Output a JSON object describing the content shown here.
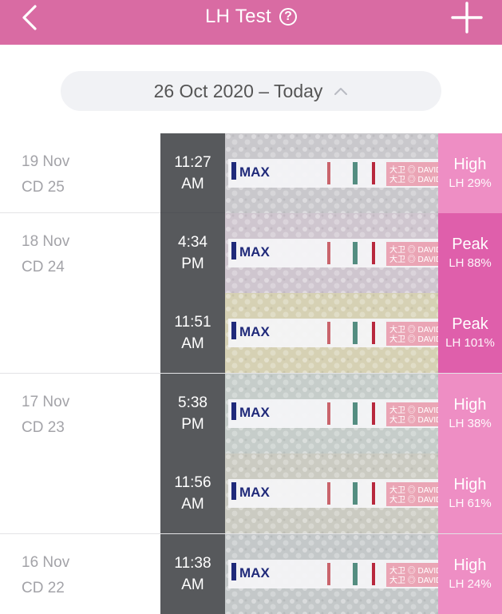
{
  "header": {
    "title": "LH Test",
    "help_symbol": "?",
    "back_icon": "chevron-left-icon",
    "add_icon": "plus-icon",
    "background_color": "#d96ba3"
  },
  "date_range": {
    "label": "26 Oct 2020 – Today",
    "toggle_icon": "chevron-up-icon"
  },
  "tests": [
    {
      "date": "19 Nov",
      "cycle_day": "CD 25",
      "time": "11:27",
      "ampm": "AM",
      "result": "High",
      "lh": "LH 29%",
      "strip_text": "MAX"
    },
    {
      "date": "18 Nov",
      "cycle_day": "CD 24",
      "time": "4:34",
      "ampm": "PM",
      "result": "Peak",
      "lh": "LH 88%",
      "strip_text": "MAX"
    },
    {
      "date": "",
      "cycle_day": "",
      "time": "11:51",
      "ampm": "AM",
      "result": "Peak",
      "lh": "LH 101%",
      "strip_text": "MAX"
    },
    {
      "date": "17 Nov",
      "cycle_day": "CD 23",
      "time": "5:38",
      "ampm": "PM",
      "result": "High",
      "lh": "LH 38%",
      "strip_text": "MAX"
    },
    {
      "date": "",
      "cycle_day": "",
      "time": "11:56",
      "ampm": "AM",
      "result": "High",
      "lh": "LH 61%",
      "strip_text": "MAX"
    },
    {
      "date": "16 Nov",
      "cycle_day": "CD 22",
      "time": "11:38",
      "ampm": "AM",
      "result": "High",
      "lh": "LH 24%",
      "strip_text": "MAX"
    }
  ],
  "colors": {
    "high": "#ee8ec4",
    "peak": "#df5fab"
  }
}
